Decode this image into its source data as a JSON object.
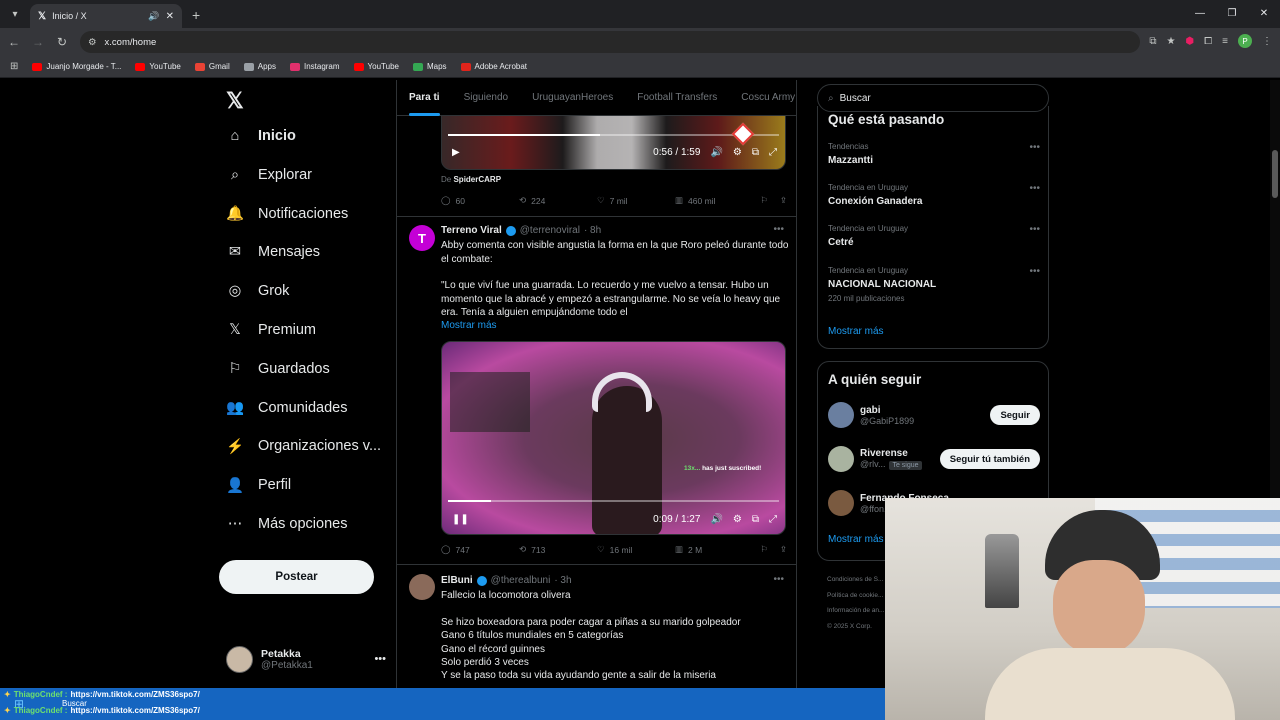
{
  "browser": {
    "tab_title": "Inicio / X",
    "url": "x.com/home",
    "profile_initial": "P",
    "bookmarks": [
      {
        "label": "Juanjo Morgade - T...",
        "color": "#ff0000"
      },
      {
        "label": "YouTube",
        "color": "#ff0000"
      },
      {
        "label": "Gmail",
        "color": "#ea4335"
      },
      {
        "label": "Apps",
        "color": "#9aa0a6"
      },
      {
        "label": "Instagram",
        "color": "#e1306c"
      },
      {
        "label": "YouTube",
        "color": "#ff0000"
      },
      {
        "label": "Maps",
        "color": "#34a853"
      },
      {
        "label": "Adobe Acrobat",
        "color": "#e0241b"
      }
    ]
  },
  "nav": {
    "items": [
      {
        "label": "Inicio",
        "icon": "home-icon"
      },
      {
        "label": "Explorar",
        "icon": "search-icon"
      },
      {
        "label": "Notificaciones",
        "icon": "bell-icon"
      },
      {
        "label": "Mensajes",
        "icon": "mail-icon"
      },
      {
        "label": "Grok",
        "icon": "grok-icon"
      },
      {
        "label": "Premium",
        "icon": "x-premium-icon"
      },
      {
        "label": "Guardados",
        "icon": "bookmark-icon"
      },
      {
        "label": "Comunidades",
        "icon": "communities-icon"
      },
      {
        "label": "Organizaciones v...",
        "icon": "lightning-icon"
      },
      {
        "label": "Perfil",
        "icon": "person-icon"
      },
      {
        "label": "Más opciones",
        "icon": "more-circle-icon"
      }
    ],
    "post_button": "Postear",
    "account": {
      "name": "Petakka",
      "handle": "@Petakka1"
    }
  },
  "feed": {
    "tabs": [
      "Para ti",
      "Siguiendo",
      "UruguayanHeroes",
      "Football Transfers",
      "Coscu Army"
    ],
    "post0": {
      "video_time": "0:56 / 1:59",
      "video_progress": 0.46,
      "from_prefix": "De",
      "from_user": "SpiderCARP",
      "replies": "60",
      "retweets": "224",
      "likes": "7 mil",
      "views": "460 mil"
    },
    "post1": {
      "name": "Terreno Viral",
      "handle": "@terrenoviral",
      "time": "· 8h",
      "text1": "Abby comenta con visible angustia la forma en la que Roro peleó durante todo el combate:",
      "text2": "\"Lo que viví fue una guarrada. Lo recuerdo y me vuelvo a tensar. Hubo un momento que la abracé y empezó a estrangularme. No se veía lo heavy que era. Tenía a alguien empujándome todo el",
      "show_more": "Mostrar más",
      "video_time": "0:09 / 1:27",
      "video_progress": 0.13,
      "overlay_sub": "has just suscribed!",
      "replies": "747",
      "retweets": "713",
      "likes": "16 mil",
      "views": "2 M"
    },
    "post2": {
      "name": "ElBuni",
      "handle": "@therealbuni",
      "time": "· 3h",
      "lines": [
        "Fallecio la locomotora olivera",
        "",
        "Se hizo boxeadora para poder cagar a piñas a su marido golpeador",
        "Gano 6 títulos mundiales en 5 categorías",
        "Gano el récord guinnes",
        "Solo perdió 3 veces",
        "Y se la paso toda su vida ayudando gente a salir de la miseria"
      ]
    }
  },
  "right": {
    "search_placeholder": "Buscar",
    "trends_title": "Qué está pasando",
    "trends": [
      {
        "meta": "Tendencias",
        "name": "Mazzantti",
        "count": ""
      },
      {
        "meta": "Tendencia en Uruguay",
        "name": "Conexión Ganadera",
        "count": ""
      },
      {
        "meta": "Tendencia en Uruguay",
        "name": "Cetré",
        "count": ""
      },
      {
        "meta": "Tendencia en Uruguay",
        "name": "NACIONAL NACIONAL",
        "count": "220 mil publicaciones"
      }
    ],
    "show_more": "Mostrar más",
    "who_title": "A quién seguir",
    "who": [
      {
        "name": "gabi",
        "handle": "@GabiP1899",
        "tag": "",
        "button": "Seguir",
        "color": "#6a7fa0"
      },
      {
        "name": "Riverense",
        "handle": "@rlv...",
        "tag": "Te sigue",
        "button": "Seguir tú también",
        "color": "#a9b3a0"
      },
      {
        "name": "Fernando Fonseca",
        "handle": "@ffon...",
        "tag": "",
        "button": "",
        "color": "#7a5a40"
      }
    ],
    "who_show_more": "Mostrar más",
    "footer": [
      "Condiciones de S...",
      "Política de cookie...",
      "Información de an...",
      "© 2025 X Corp."
    ]
  },
  "stream": {
    "chat": [
      {
        "user": "ThiagoCndef :",
        "msg": "https://vm.tiktok.com/ZMS36spo7/"
      },
      {
        "user": "ThiagoCndef :",
        "msg": "https://vm.tiktok.com/ZMS36spo7/"
      }
    ],
    "taskbar_search": "Buscar"
  }
}
